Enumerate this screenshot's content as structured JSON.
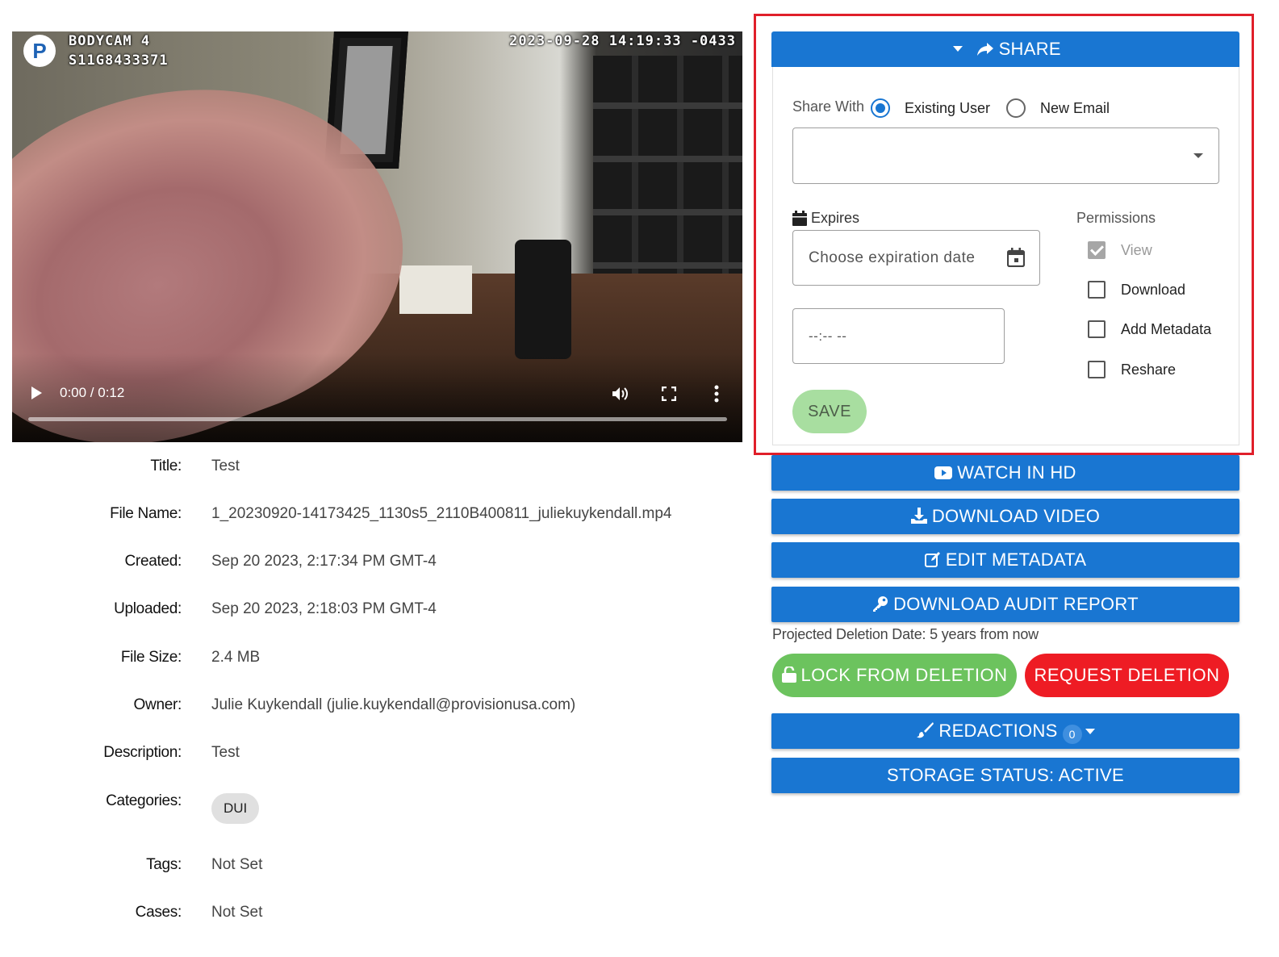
{
  "video": {
    "overlay_line1": "BODYCAM 4",
    "overlay_line2": "S11G8433371",
    "overlay_timestamp": "2023-09-28 14:19:33 -0433",
    "logo_letter": "P",
    "time_display": "0:00 / 0:12",
    "progress": 0
  },
  "metadata": {
    "title": {
      "label": "Title:",
      "value": "Test"
    },
    "file_name": {
      "label": "File Name:",
      "value": "1_20230920-14173425_1130s5_2110B400811_juliekuykendall.mp4"
    },
    "created": {
      "label": "Created:",
      "value": "Sep 20 2023, 2:17:34 PM GMT-4"
    },
    "uploaded": {
      "label": "Uploaded:",
      "value": "Sep 20 2023, 2:18:03 PM GMT-4"
    },
    "file_size": {
      "label": "File Size:",
      "value": "2.4 MB"
    },
    "owner": {
      "label": "Owner:",
      "value": "Julie Kuykendall (julie.kuykendall@provisionusa.com)"
    },
    "description": {
      "label": "Description:",
      "value": "Test"
    },
    "categories": {
      "label": "Categories:",
      "chips": [
        "DUI"
      ]
    },
    "tags": {
      "label": "Tags:",
      "value": "Not Set"
    },
    "cases": {
      "label": "Cases:",
      "value": "Not Set"
    }
  },
  "share": {
    "header_label": "SHARE",
    "share_with_label": "Share With",
    "option_existing": "Existing User",
    "option_new": "New Email",
    "selected_option": "existing",
    "user_select_value": "",
    "expires_label": "Expires",
    "date_placeholder": "Choose expiration date",
    "time_placeholder": "--:-- --",
    "permissions_label": "Permissions",
    "permissions": [
      {
        "label": "View",
        "checked": true,
        "disabled": true
      },
      {
        "label": "Download",
        "checked": false,
        "disabled": false
      },
      {
        "label": "Add Metadata",
        "checked": false,
        "disabled": false
      },
      {
        "label": "Reshare",
        "checked": false,
        "disabled": false
      }
    ],
    "save_label": "SAVE"
  },
  "actions": {
    "watch_hd": "WATCH IN HD",
    "download_video": "DOWNLOAD VIDEO",
    "edit_metadata": "EDIT METADATA",
    "download_audit": "DOWNLOAD AUDIT REPORT",
    "projected_deletion": "Projected Deletion Date: 5 years from now",
    "lock_deletion": "LOCK FROM DELETION",
    "request_deletion": "REQUEST DELETION",
    "redactions": "REDACTIONS",
    "redactions_count": "0",
    "storage_status": "STORAGE STATUS: ACTIVE"
  },
  "colors": {
    "primary_blue": "#1976d2",
    "highlight_red": "#e01f2a",
    "lock_green": "#6cc35e",
    "delete_red": "#ee1c24",
    "save_green": "#a8dea0"
  },
  "icons": [
    "share-icon",
    "calendar-icon",
    "youtube-icon",
    "download-icon",
    "edit-icon",
    "key-icon",
    "unlock-icon",
    "brush-icon",
    "play-icon",
    "volume-icon",
    "fullscreen-icon",
    "more-vert-icon"
  ]
}
